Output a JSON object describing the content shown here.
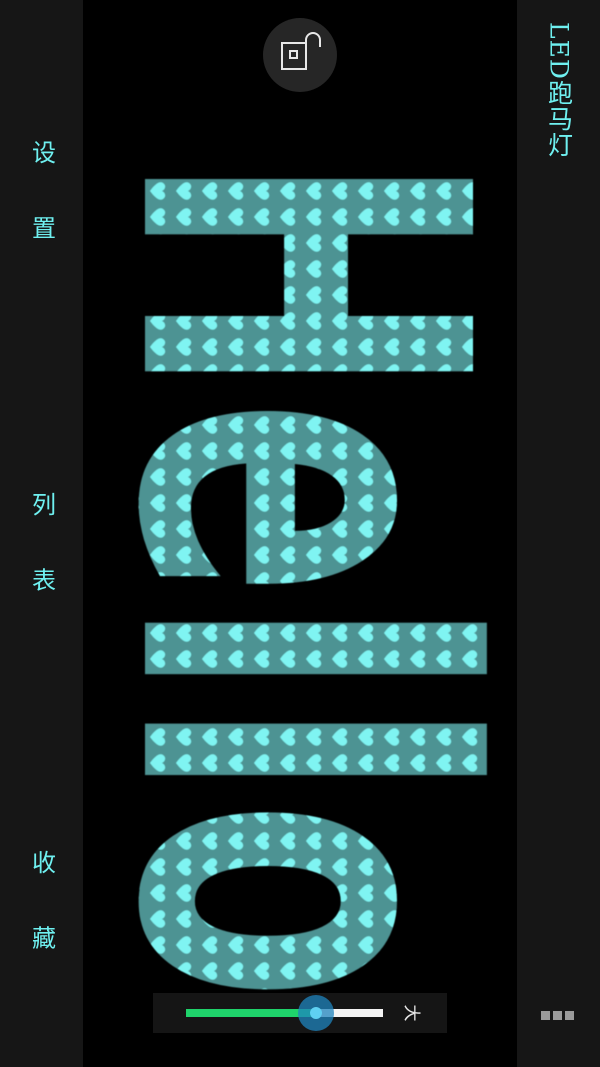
{
  "app": {
    "title": "LED跑马灯",
    "text_color": "#6ff0f0",
    "panel_color": "#161616",
    "background_color": "#000000"
  },
  "menu": {
    "settings_label": "设 置",
    "list_label": "列 表",
    "favorites_label": "收 藏"
  },
  "marquee": {
    "text": "Hello",
    "pattern": "heart-pattern",
    "pattern_base_color": "#4e9393",
    "pattern_heart_color": "#7ff4f2"
  },
  "icons": {
    "lock": "lock-open-icon",
    "more": "more-icon"
  },
  "size_slider": {
    "label": "大",
    "value_percent": 66,
    "fill_color": "#1fd36b",
    "thumb_color": "#1f84be"
  }
}
